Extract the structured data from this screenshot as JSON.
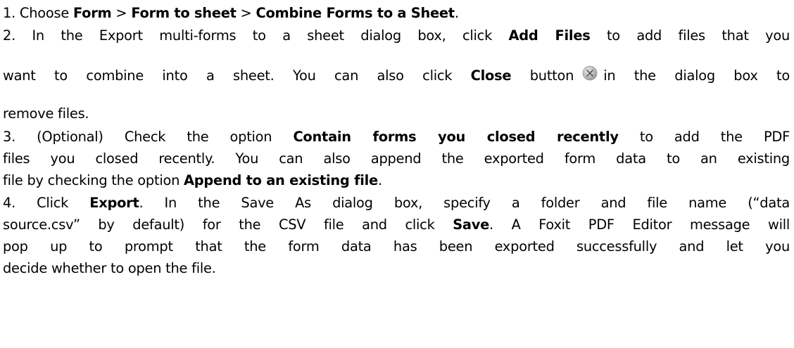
{
  "steps": [
    {
      "num": "1.",
      "t1": " Choose ",
      "b1": "Form",
      "t2": " > ",
      "b2": "Form to sheet",
      "t3": " > ",
      "b3": "Combine Forms to a Sheet",
      "t4": "."
    },
    {
      "num": "2.",
      "l1a": " In the Export multi-forms to a sheet dialog box, click ",
      "l1b": "Add Files",
      "l1c": " to add files that you",
      "l2a": "want to combine into a sheet. You can also click ",
      "l2b": "Close",
      "l2c": " button",
      "l2d": "in the dialog box to",
      "l3": "remove files.",
      "icon": "close-circle-icon"
    },
    {
      "num": "3.",
      "l1a": " (Optional) Check the option ",
      "l1b": "Contain forms you closed recently",
      "l1c": " to add the PDF",
      "l2": "files you closed recently. You can also append the exported form data to an existing",
      "l3a": "file by checking the option ",
      "l3b": "Append to an existing file",
      "l3c": "."
    },
    {
      "num": "4.",
      "l1a": " Click ",
      "l1b": "Export",
      "l1c": ". In the Save As dialog box, specify a folder and file name (“data",
      "l2a": "source.csv” by default) for the CSV file and click ",
      "l2b": "Save",
      "l2c": ". A Foxit PDF Editor message will",
      "l3": "pop up to prompt that the form data has been exported successfully and let you",
      "l4": "decide whether to open the file."
    }
  ]
}
